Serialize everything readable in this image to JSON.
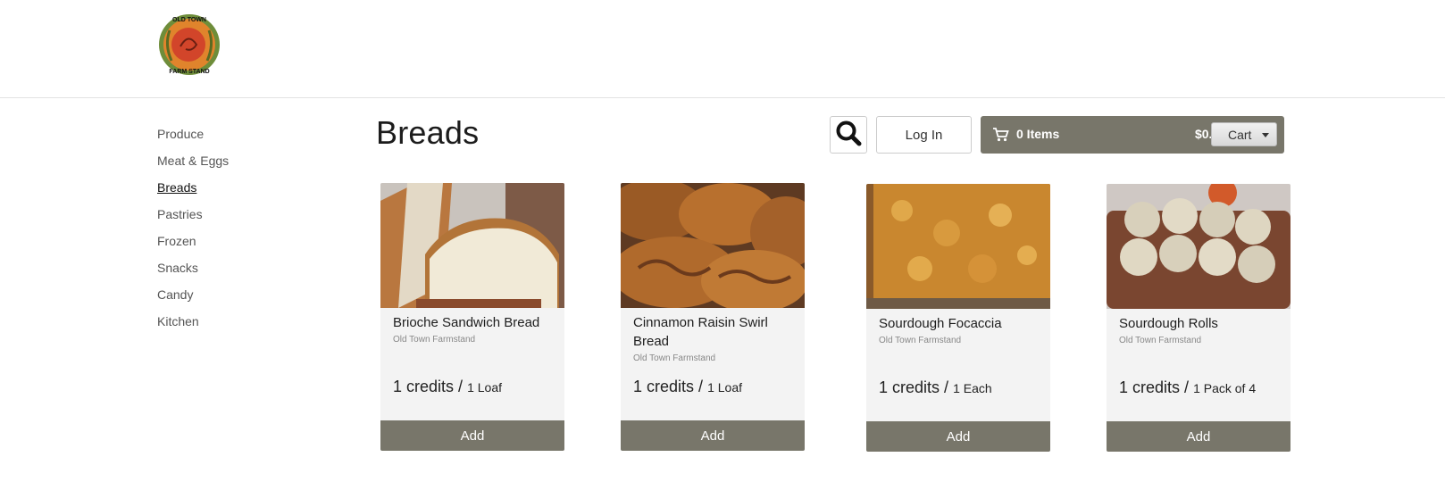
{
  "header": {
    "logo_lines": [
      "OLD TOWN",
      "FARM STAND"
    ]
  },
  "sidebar": {
    "items": [
      {
        "label": "Produce",
        "active": false
      },
      {
        "label": "Meat & Eggs",
        "active": false
      },
      {
        "label": "Breads",
        "active": true
      },
      {
        "label": "Pastries",
        "active": false
      },
      {
        "label": "Frozen",
        "active": false
      },
      {
        "label": "Snacks",
        "active": false
      },
      {
        "label": "Candy",
        "active": false
      },
      {
        "label": "Kitchen",
        "active": false
      }
    ]
  },
  "page": {
    "title": "Breads"
  },
  "toolbar": {
    "search_icon": "search-icon",
    "login_label": "Log In",
    "cart": {
      "items_label": "0 Items",
      "total": "$0.00",
      "dropdown_label": "Cart",
      "icon": "cart-icon"
    }
  },
  "products": [
    {
      "name": "Brioche Sandwich Bread",
      "vendor": "Old Town Farmstand",
      "price": "1 credits",
      "separator": "/",
      "unit": "1 Loaf",
      "add_label": "Add"
    },
    {
      "name": "Cinnamon Raisin Swirl Bread",
      "vendor": "Old Town Farmstand",
      "price": "1 credits",
      "separator": "/",
      "unit": "1 Loaf",
      "add_label": "Add"
    },
    {
      "name": "Sourdough Focaccia",
      "vendor": "Old Town Farmstand",
      "price": "1 credits",
      "separator": "/",
      "unit": "1 Each",
      "add_label": "Add"
    },
    {
      "name": "Sourdough Rolls",
      "vendor": "Old Town Farmstand",
      "price": "1 credits",
      "separator": "/",
      "unit": "1 Pack of 4",
      "add_label": "Add"
    }
  ],
  "colors": {
    "accent": "#78766a",
    "product_bg": "#f3f3f3"
  }
}
